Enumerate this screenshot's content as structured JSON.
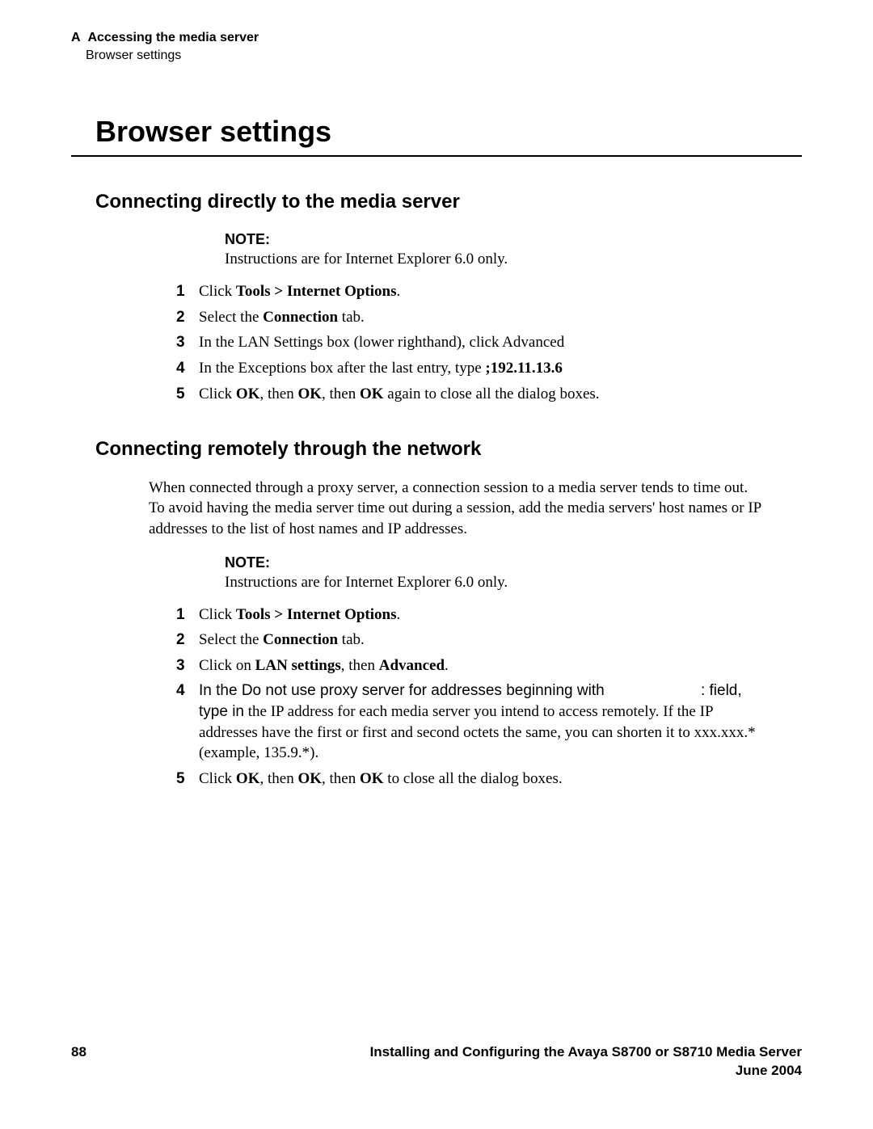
{
  "header": {
    "appendix": "A",
    "chapter": "Accessing the media server",
    "section": "Browser settings"
  },
  "title": "Browser settings",
  "section1": {
    "heading": "Connecting directly to the media server",
    "note_label": "NOTE:",
    "note_text": "Instructions are for Internet Explorer 6.0 only.",
    "steps": [
      {
        "n": "1",
        "pre": "Click ",
        "b1": "Tools > Internet Options",
        "post": "."
      },
      {
        "n": "2",
        "pre": "Select the ",
        "b1": "Connection",
        "post": " tab."
      },
      {
        "n": "3",
        "plain": "In the LAN Settings box (lower righthand), click Advanced"
      },
      {
        "n": "4",
        "pre": "In the Exceptions box after the last entry, type ",
        "b1": ";192.11.13.6",
        "post": ""
      },
      {
        "n": "5",
        "pre": "Click ",
        "b1": "OK",
        "mid1": ", then ",
        "b2": "OK",
        "mid2": ", then ",
        "b3": "OK",
        "post": " again to close all the dialog boxes."
      }
    ]
  },
  "section2": {
    "heading": "Connecting remotely through the network",
    "intro": "When connected through a proxy server, a connection session to a media server tends to time out. To avoid having the media server time out during a session, add the media servers' host names or IP addresses to the list of host names and IP addresses.",
    "note_label": "NOTE:",
    "note_text": "Instructions are for Internet Explorer 6.0 only.",
    "steps": [
      {
        "n": "1",
        "pre": "Click ",
        "b1": "Tools > Internet Options",
        "post": "."
      },
      {
        "n": "2",
        "pre": "Select the ",
        "b1": "Connection",
        "post": " tab."
      },
      {
        "n": "3",
        "pre": "Click on ",
        "b1": "LAN settings",
        "mid1": ", then ",
        "b2": "Advanced",
        "post": "."
      },
      {
        "n": "4",
        "sans_pre": "In the ",
        "sans_field": "Do not use proxy server for addresses beginning with",
        "sans_post": " : field, type in",
        "cont": "the IP address for each media server you intend to access remotely. If the IP addresses have the first or first and second octets the same, you can shorten it to xxx.xxx.* (example, 135.9.*)."
      },
      {
        "n": "5",
        "pre": "Click ",
        "b1": "OK",
        "mid1": ", then ",
        "b2": "OK",
        "mid2": ", then ",
        "b3": "OK",
        "post": " to close all the dialog boxes."
      }
    ]
  },
  "footer": {
    "page": "88",
    "doc": "Installing and Configuring the Avaya S8700 or S8710 Media Server",
    "date": "June 2004"
  }
}
